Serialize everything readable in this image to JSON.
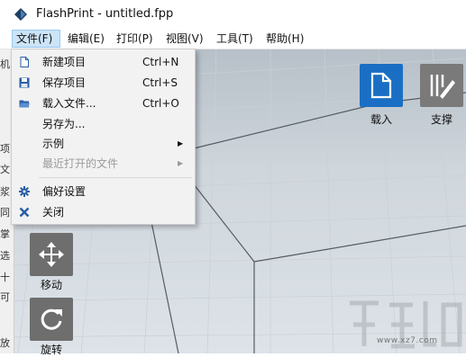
{
  "window": {
    "title": "FlashPrint - untitled.fpp",
    "icon": "flashprint-logo-icon"
  },
  "menubar": {
    "items": [
      {
        "label": "文件(F)",
        "active": true
      },
      {
        "label": "编辑(E)",
        "active": false
      },
      {
        "label": "打印(P)",
        "active": false
      },
      {
        "label": "视图(V)",
        "active": false
      },
      {
        "label": "工具(T)",
        "active": false
      },
      {
        "label": "帮助(H)",
        "active": false
      }
    ]
  },
  "file_menu": {
    "items": [
      {
        "label": "新建项目",
        "shortcut": "Ctrl+N",
        "icon": "new-file-icon",
        "enabled": true
      },
      {
        "label": "保存项目",
        "shortcut": "Ctrl+S",
        "icon": "save-icon",
        "enabled": true
      },
      {
        "label": "载入文件...",
        "shortcut": "Ctrl+O",
        "icon": "open-folder-icon",
        "enabled": true
      },
      {
        "label": "另存为...",
        "shortcut": "",
        "icon": "",
        "enabled": true
      },
      {
        "label": "示例",
        "shortcut": "",
        "icon": "",
        "enabled": true,
        "submenu": true
      },
      {
        "label": "最近打开的文件",
        "shortcut": "",
        "icon": "",
        "enabled": false,
        "submenu": true
      },
      {
        "label": "偏好设置",
        "shortcut": "",
        "icon": "gear-icon",
        "enabled": true
      },
      {
        "label": "关闭",
        "shortcut": "",
        "icon": "close-icon",
        "enabled": true
      }
    ]
  },
  "toolbar_right": {
    "load_label": "载入",
    "support_label": "支撑",
    "load_color": "#1a6fc4",
    "support_color": "#7a7a7a"
  },
  "toolbar_left": {
    "move_label": "移动",
    "rotate_label": "旋转",
    "button_color": "#6e6e6e"
  },
  "left_strip": {
    "chars": [
      "机",
      "项",
      "文",
      "浆",
      "同",
      "掌",
      "选",
      "十",
      "可",
      "放"
    ]
  },
  "watermark": {
    "text": "www.xz7.com"
  }
}
